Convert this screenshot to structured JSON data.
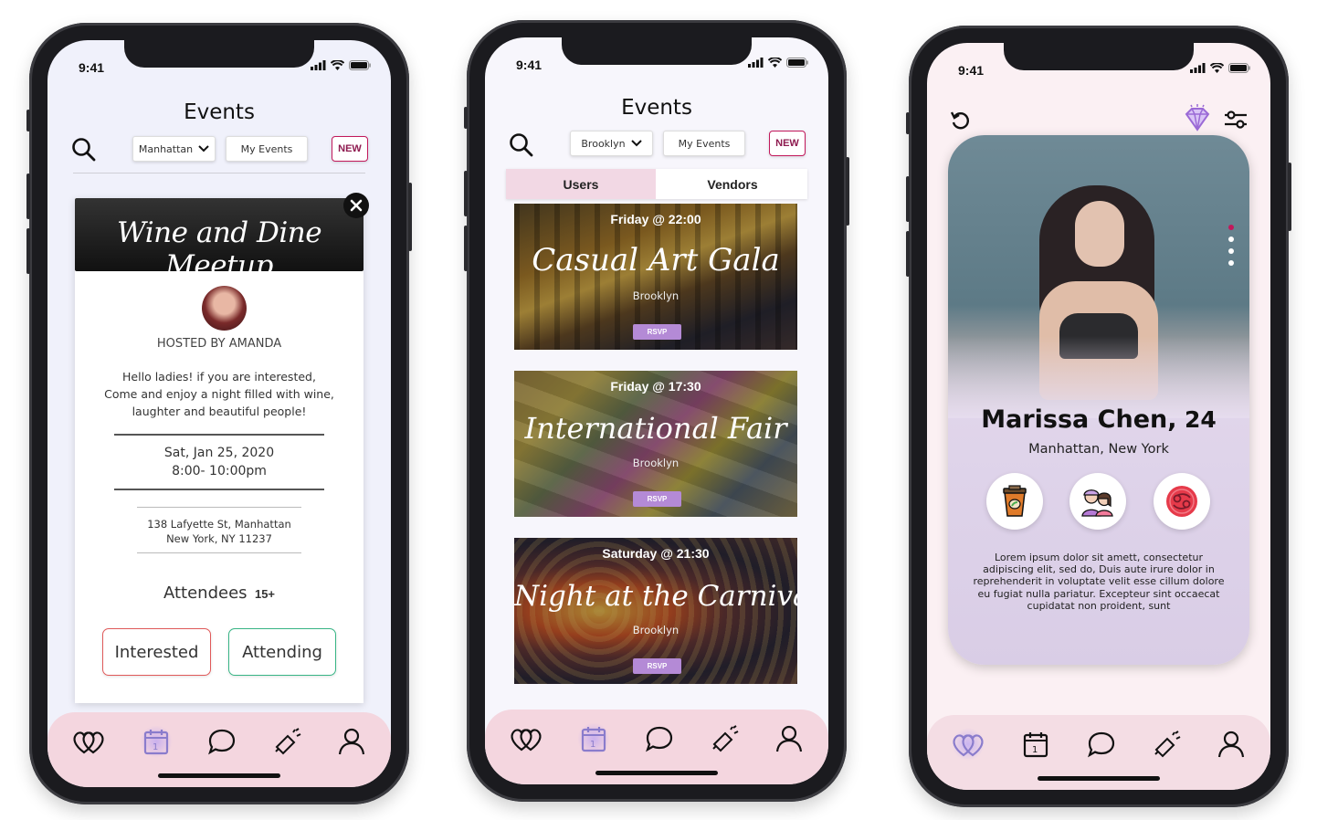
{
  "status_time": "9:41",
  "phone1": {
    "title": "Events",
    "location_filter": "Manhattan",
    "my_events_label": "My Events",
    "new_label": "NEW",
    "event_title": "Wine and Dine Meetup",
    "host": "HOSTED BY AMANDA",
    "description_lines": [
      "Hello ladies! if you are interested,",
      "Come and enjoy a night filled with wine,",
      "laughter  and beautiful people!"
    ],
    "date": "Sat, Jan 25, 2020",
    "time": "8:00- 10:00pm",
    "address_line1": "138 Lafyette St, Manhattan",
    "address_line2": "New York, NY 11237",
    "attendees_label": "Attendees",
    "attendees_count": "15+",
    "interested_label": "Interested",
    "attending_label": "Attending"
  },
  "phone2": {
    "title": "Events",
    "location_filter": "Brooklyn",
    "my_events_label": "My Events",
    "new_label": "NEW",
    "tabs": [
      "Users",
      "Vendors"
    ],
    "events": [
      {
        "when": "Friday @ 22:00",
        "name": "Casual Art Gala",
        "place": "Brooklyn",
        "rsvp": "RSVP"
      },
      {
        "when": "Friday @ 17:30",
        "name": "International Fair",
        "place": "Brooklyn",
        "rsvp": "RSVP"
      },
      {
        "when": "Saturday @ 21:30",
        "name": "Night at the Carnival",
        "place": "Brooklyn",
        "rsvp": "RSVP"
      }
    ]
  },
  "phone3": {
    "name": "Marissa Chen,",
    "age": "24",
    "location": "Manhattan, New York",
    "bio_lines": [
      "Lorem ipsum dolor sit amett, consectetur",
      "adipiscing elit, sed do, Duis aute irure dolor in",
      "reprehenderit in voluptate velit esse cillum dolore",
      "eu fugiat nulla pariatur. Excepteur sint occaecat",
      "cupidatat non proident, sunt"
    ],
    "interest_icons": [
      "coffee-cup-icon",
      "friends-icon",
      "cancer-zodiac-icon"
    ]
  },
  "nav_icons": [
    "hearts-icon",
    "calendar-icon",
    "chat-icon",
    "megaphone-icon",
    "profile-icon"
  ],
  "colors": {
    "accent_pink": "#c2185b",
    "tabbar": "#f4d6df",
    "interested": "#e05a5a",
    "attending": "#38b585",
    "rsvp": "#b48ad6"
  }
}
